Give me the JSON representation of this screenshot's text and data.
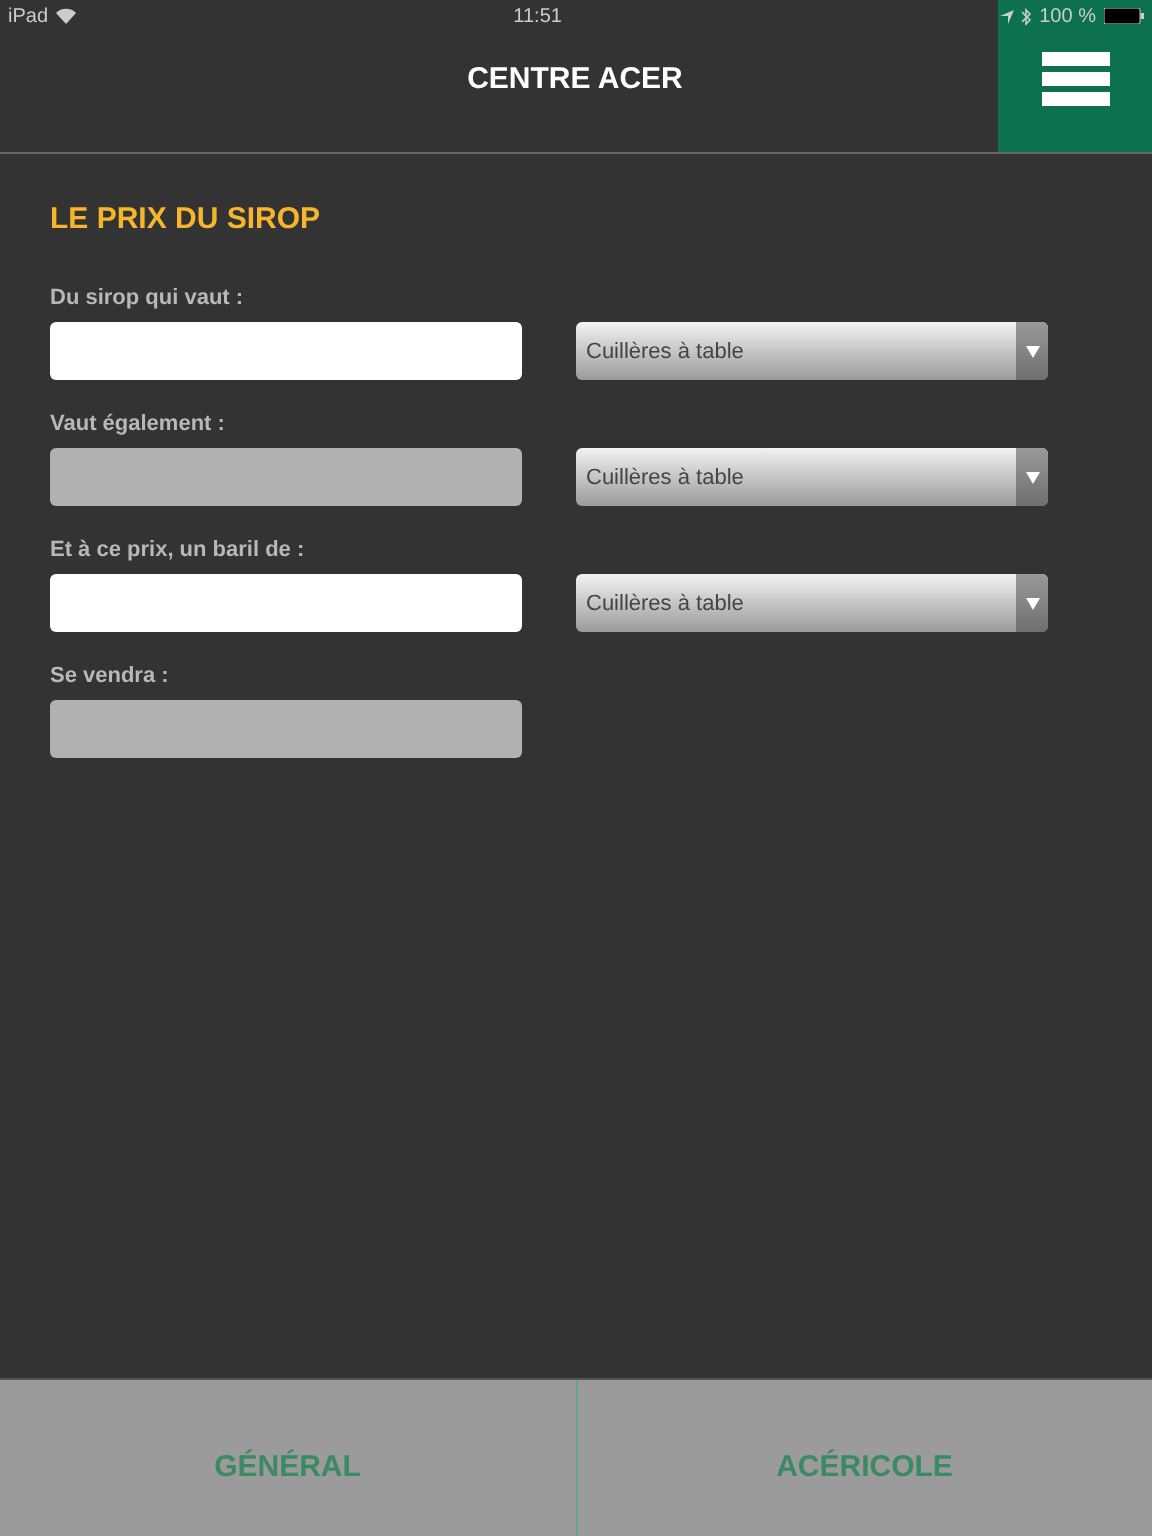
{
  "status_bar": {
    "device": "iPad",
    "time": "11:51",
    "battery": "100 %"
  },
  "header": {
    "title": "CENTRE ACER"
  },
  "section": {
    "title": "LE PRIX DU SIROP",
    "rows": [
      {
        "label": "Du sirop qui vaut :",
        "field": {
          "disabled": false
        },
        "unit": "Cuillères à table"
      },
      {
        "label": "Vaut également :",
        "field": {
          "disabled": true
        },
        "unit": "Cuillères à table"
      },
      {
        "label": "Et à ce prix, un baril de :",
        "field": {
          "disabled": false
        },
        "unit": "Cuillères à table"
      },
      {
        "label": "Se vendra :",
        "field": {
          "disabled": true
        }
      }
    ]
  },
  "tabs": [
    {
      "label": "GÉNÉRAL"
    },
    {
      "label": "ACÉRICOLE"
    }
  ]
}
